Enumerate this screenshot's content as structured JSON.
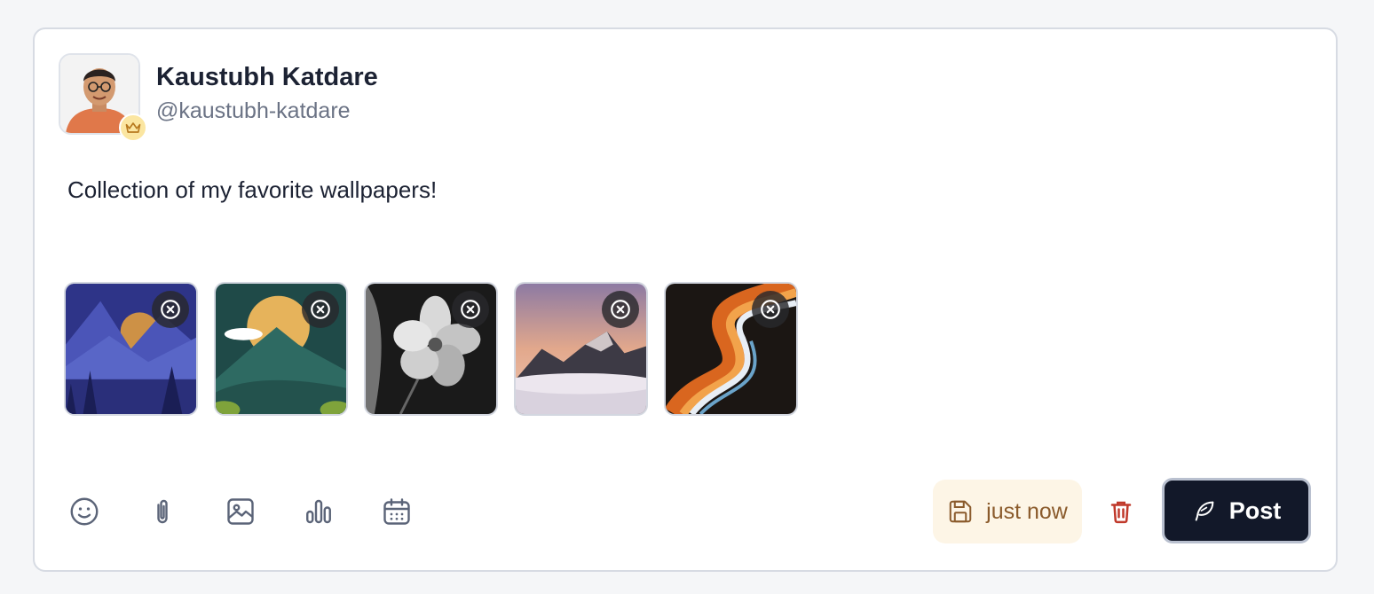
{
  "author": {
    "name": "Kaustubh Katdare",
    "handle": "@kaustubh-katdare",
    "badge_icon": "crown-icon"
  },
  "post": {
    "text": "Collection of my favorite wallpapers!"
  },
  "attachments": [
    {
      "subject": "blue-mountain-landscape",
      "remove_icon": "close-circle-icon"
    },
    {
      "subject": "green-hill-sunset",
      "remove_icon": "close-circle-icon"
    },
    {
      "subject": "monochrome-hibiscus-flower",
      "remove_icon": "close-circle-icon"
    },
    {
      "subject": "misty-mountain-peaks",
      "remove_icon": "close-circle-icon"
    },
    {
      "subject": "abstract-orange-swirl",
      "remove_icon": "close-circle-icon"
    }
  ],
  "toolbar": {
    "tools": [
      "emoji-icon",
      "paperclip-icon",
      "image-icon",
      "poll-chart-icon",
      "calendar-icon"
    ]
  },
  "draft_status": {
    "label": "just now",
    "icon": "save-icon"
  },
  "actions": {
    "delete_icon": "trash-icon",
    "post_label": "Post",
    "post_icon": "feather-icon"
  },
  "colors": {
    "primary_button": "#121829",
    "delete": "#c0392b",
    "saved_background": "#fdf5e6",
    "saved_text": "#8a5a2b"
  }
}
